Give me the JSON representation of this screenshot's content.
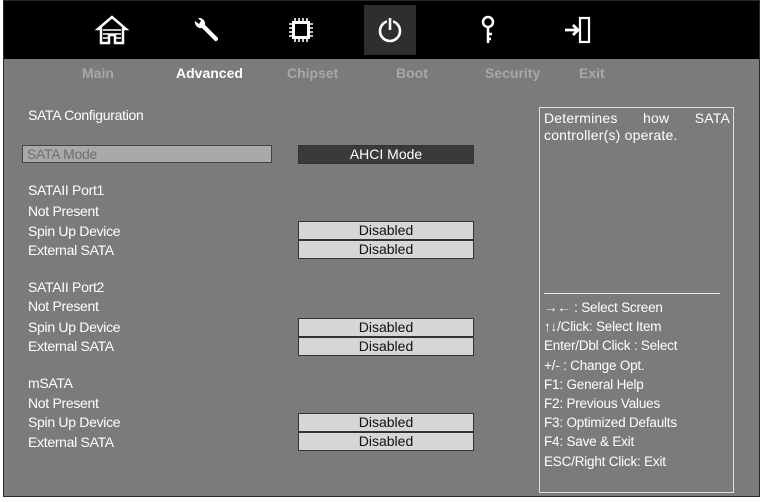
{
  "colors": {
    "background": "#7b7b7b",
    "iconbar": "#000000",
    "active_tab": "#ffffff",
    "inactive_tab": "#a8a8a8",
    "value_box": "#d6d6d6",
    "selected_value_box": "#3a3a3a"
  },
  "toolbar": {
    "icons": [
      "home-icon",
      "wrench-icon",
      "chip-icon",
      "power-icon",
      "key-icon",
      "exit-icon"
    ],
    "selected_icon": "power-icon"
  },
  "tabs": [
    "Main",
    "Advanced",
    "Chipset",
    "Boot",
    "Security",
    "Exit"
  ],
  "active_tab": "Advanced",
  "section_title": "SATA Configuration",
  "sata_mode": {
    "label": "SATA Mode",
    "value": "AHCI Mode"
  },
  "ports": [
    {
      "name": "SATAII Port1",
      "status": "Not Present",
      "spin_label": "Spin Up Device",
      "spin_value": "Disabled",
      "ext_label": "External SATA",
      "ext_value": "Disabled"
    },
    {
      "name": "SATAII Port2",
      "status": "Not Present",
      "spin_label": "Spin Up Device",
      "spin_value": "Disabled",
      "ext_label": "External SATA",
      "ext_value": "Disabled"
    },
    {
      "name": "mSATA",
      "status": "Not Present",
      "spin_label": "Spin Up Device",
      "spin_value": "Disabled",
      "ext_label": "External SATA",
      "ext_value": "Disabled"
    }
  ],
  "help": {
    "description": "Determines how SATA controller(s) operate.",
    "keys": [
      "→←  : Select Screen",
      "↑↓/Click: Select Item",
      "Enter/Dbl Click : Select",
      "+/- : Change Opt.",
      "F1: General Help",
      "F2: Previous Values",
      "F3: Optimized Defaults",
      "F4: Save & Exit",
      "ESC/Right Click: Exit"
    ]
  }
}
